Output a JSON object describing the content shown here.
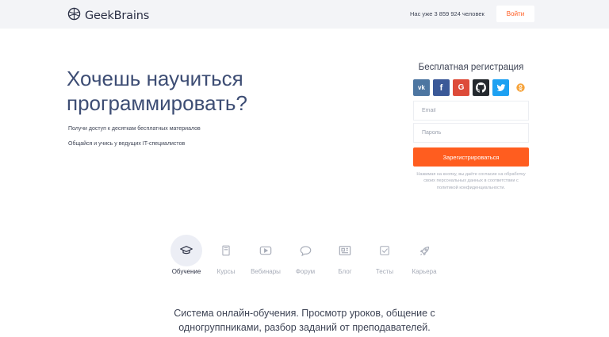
{
  "header": {
    "logo_text": "GeekBrains",
    "user_count": "Нас уже 3 859 924 человек",
    "login_label": "Войти"
  },
  "hero": {
    "headline": "Хочешь научиться программировать?",
    "line1": "Получи доступ к десяткам бесплатных материалов",
    "line2": "Общайся и учись у ведущих IT-специалистов"
  },
  "registration": {
    "title": "Бесплатная регистрация",
    "socials": [
      {
        "name": "vk-icon",
        "glyph": "vk",
        "color": "#4d76a1"
      },
      {
        "name": "facebook-icon",
        "glyph": "f",
        "color": "#3b5998"
      },
      {
        "name": "google-icon",
        "glyph": "G",
        "color": "#dd4b39"
      },
      {
        "name": "github-icon",
        "glyph": "",
        "color": "#24292e"
      },
      {
        "name": "twitter-icon",
        "glyph": "",
        "color": "#1da1f2"
      },
      {
        "name": "odnoklassniki-icon",
        "glyph": "",
        "color": "#f6a33a"
      }
    ],
    "email_placeholder": "Email",
    "password_placeholder": "Пароль",
    "register_label": "Зарегистрироваться",
    "terms": "Нажимая на кнопку, вы даёте согласие на обработку своих персональных данных в соответствии с политикой конфиденциальности."
  },
  "tabs": [
    {
      "label": "Обучение",
      "icon": "graduation-cap-icon",
      "active": true
    },
    {
      "label": "Курсы",
      "icon": "book-icon",
      "active": false
    },
    {
      "label": "Вебинары",
      "icon": "video-play-icon",
      "active": false
    },
    {
      "label": "Форум",
      "icon": "chat-bubble-icon",
      "active": false
    },
    {
      "label": "Блог",
      "icon": "newspaper-icon",
      "active": false
    },
    {
      "label": "Тесты",
      "icon": "checkbox-icon",
      "active": false
    },
    {
      "label": "Карьера",
      "icon": "rocket-icon",
      "active": false
    }
  ],
  "description": "Система онлайн-обучения. Просмотр уроков, общение с одногруппниками, разбор заданий от преподавателей.",
  "colors": {
    "accent": "#ff5d1f",
    "headline": "#3d4d74",
    "header_bg": "#f3f4f7"
  }
}
